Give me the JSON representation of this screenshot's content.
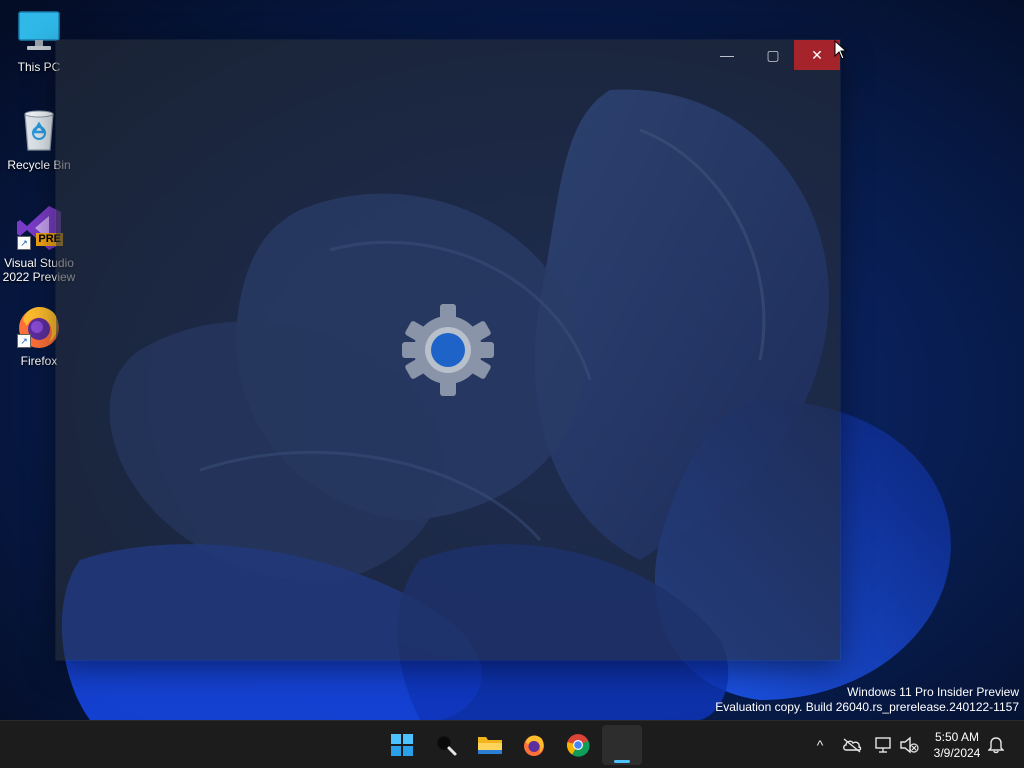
{
  "desktop": {
    "icons": [
      {
        "label": "This PC"
      },
      {
        "label": "Recycle Bin"
      },
      {
        "label": "Visual Studio 2022 Preview",
        "badge": "PRE"
      },
      {
        "label": "Firefox"
      }
    ]
  },
  "splash_window": {
    "title_buttons": {
      "minimize": "—",
      "maximize": "▢",
      "close": "✕"
    },
    "icon": "settings-gear-icon",
    "accent_color": "#1e63c8",
    "close_hover_color": "#a5232b"
  },
  "watermark": {
    "line1": "Windows 11 Pro Insider Preview",
    "line2": "Evaluation copy. Build 26040.rs_prerelease.240122-1157"
  },
  "taskbar": {
    "apps": [
      {
        "name": "start-icon"
      },
      {
        "name": "search-icon"
      },
      {
        "name": "file-explorer-icon"
      },
      {
        "name": "firefox-icon"
      },
      {
        "name": "chrome-icon"
      },
      {
        "name": "settings-app-icon",
        "active": true
      }
    ],
    "tray": {
      "chevron": "^",
      "icons": [
        "onedrive-offline-icon",
        "network-icon",
        "volume-muted-icon",
        "notification-bell-icon"
      ]
    },
    "clock": {
      "time": "5:50 AM",
      "date": "3/9/2024"
    }
  }
}
